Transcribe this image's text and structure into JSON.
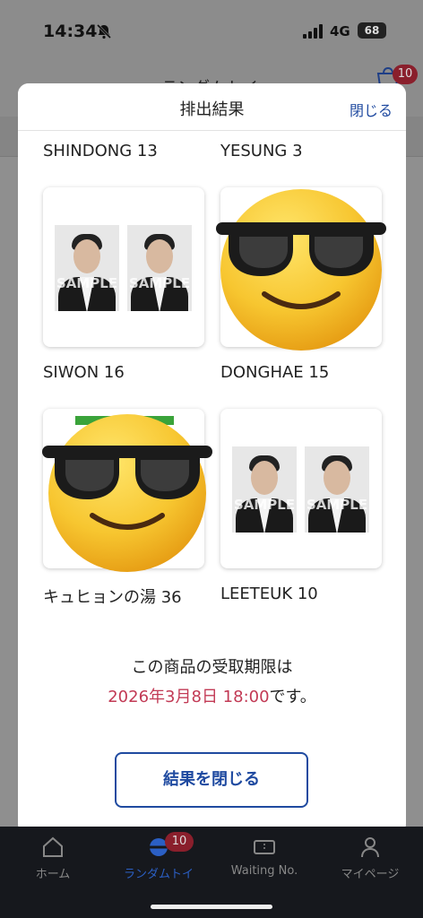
{
  "status_bar": {
    "time": "14:34",
    "network": "4G",
    "battery": "68"
  },
  "background_page": {
    "title": "ランダムトイ",
    "cart_badge": "10"
  },
  "modal": {
    "title": "排出結果",
    "close_label": "閉じる",
    "top_labels": [
      "SHINDONG 13",
      "YESUNG 3"
    ],
    "items": [
      {
        "label": "SIWON 16",
        "image": "sample-photo-pair"
      },
      {
        "label": "DONGHAE 15",
        "image": "sunglasses-emoji"
      },
      {
        "label": "キュヒョンの湯 36",
        "image": "sunglasses-emoji"
      },
      {
        "label": "LEETEUK 10",
        "image": "sample-photo-pair"
      }
    ],
    "watermark": "SAMPLE",
    "notice_line1": "この商品の受取期限は",
    "notice_date": "2026年3月8日 18:00",
    "notice_suffix": "です。",
    "close_button": "結果を閉じる"
  },
  "colors": {
    "accent_blue": "#1f4aa0",
    "date_red": "#c23a55",
    "badge": "#8a1f2c",
    "nav_bg": "#16181d"
  },
  "bottom_nav": {
    "items": [
      {
        "label": "ホーム",
        "icon": "home-icon"
      },
      {
        "label": "ランダムトイ",
        "icon": "random-toy-icon"
      },
      {
        "label": "Waiting No.",
        "icon": "ticket-icon"
      },
      {
        "label": "マイページ",
        "icon": "person-icon"
      }
    ],
    "badge": "10"
  }
}
